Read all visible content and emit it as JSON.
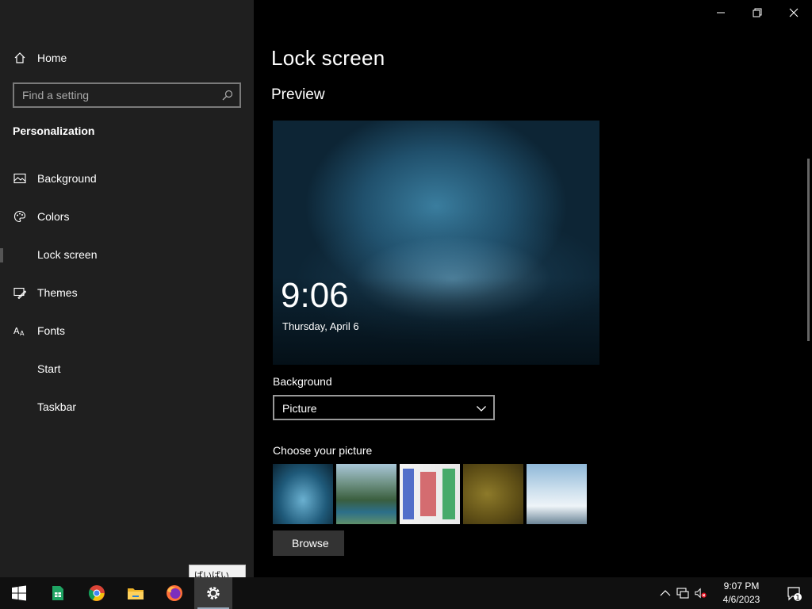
{
  "window": {
    "title": "Settings",
    "controls": [
      "minimize",
      "maximize",
      "close"
    ]
  },
  "sidebar": {
    "home_label": "Home",
    "search_placeholder": "Find a setting",
    "section_title": "Personalization",
    "items": [
      {
        "label": "Background",
        "icon": "picture-icon"
      },
      {
        "label": "Colors",
        "icon": "palette-icon"
      },
      {
        "label": "Lock screen",
        "icon": "lock-screen-icon",
        "active": true
      },
      {
        "label": "Themes",
        "icon": "brush-icon"
      },
      {
        "label": "Fonts",
        "icon": "font-icon"
      },
      {
        "label": "Start",
        "icon": "start-icon"
      },
      {
        "label": "Taskbar",
        "icon": "taskbar-icon"
      }
    ]
  },
  "main": {
    "title": "Lock screen",
    "preview_title": "Preview",
    "preview": {
      "time": "9:06",
      "date": "Thursday, April 6"
    },
    "background_label": "Background",
    "background_value": "Picture",
    "choose_label": "Choose your picture",
    "browse_label": "Browse"
  },
  "tooltip": {
    "text": "ばいばい"
  },
  "taskbar": {
    "apps": [
      {
        "name": "start-button",
        "icon": "windows-logo-icon"
      },
      {
        "name": "google-sheets",
        "icon": "sheets-icon"
      },
      {
        "name": "chrome",
        "icon": "chrome-icon"
      },
      {
        "name": "file-explorer",
        "icon": "folder-icon"
      },
      {
        "name": "firefox",
        "icon": "firefox-icon"
      },
      {
        "name": "settings",
        "icon": "gear-icon",
        "active": true
      }
    ],
    "clock_time": "9:07 PM",
    "clock_date": "4/6/2023",
    "notification_count": "1"
  },
  "colors": {
    "sidebar_bg": "#1f1f1f",
    "main_bg": "#000000",
    "taskbar_bg": "#101010",
    "text": "#ffffff"
  }
}
